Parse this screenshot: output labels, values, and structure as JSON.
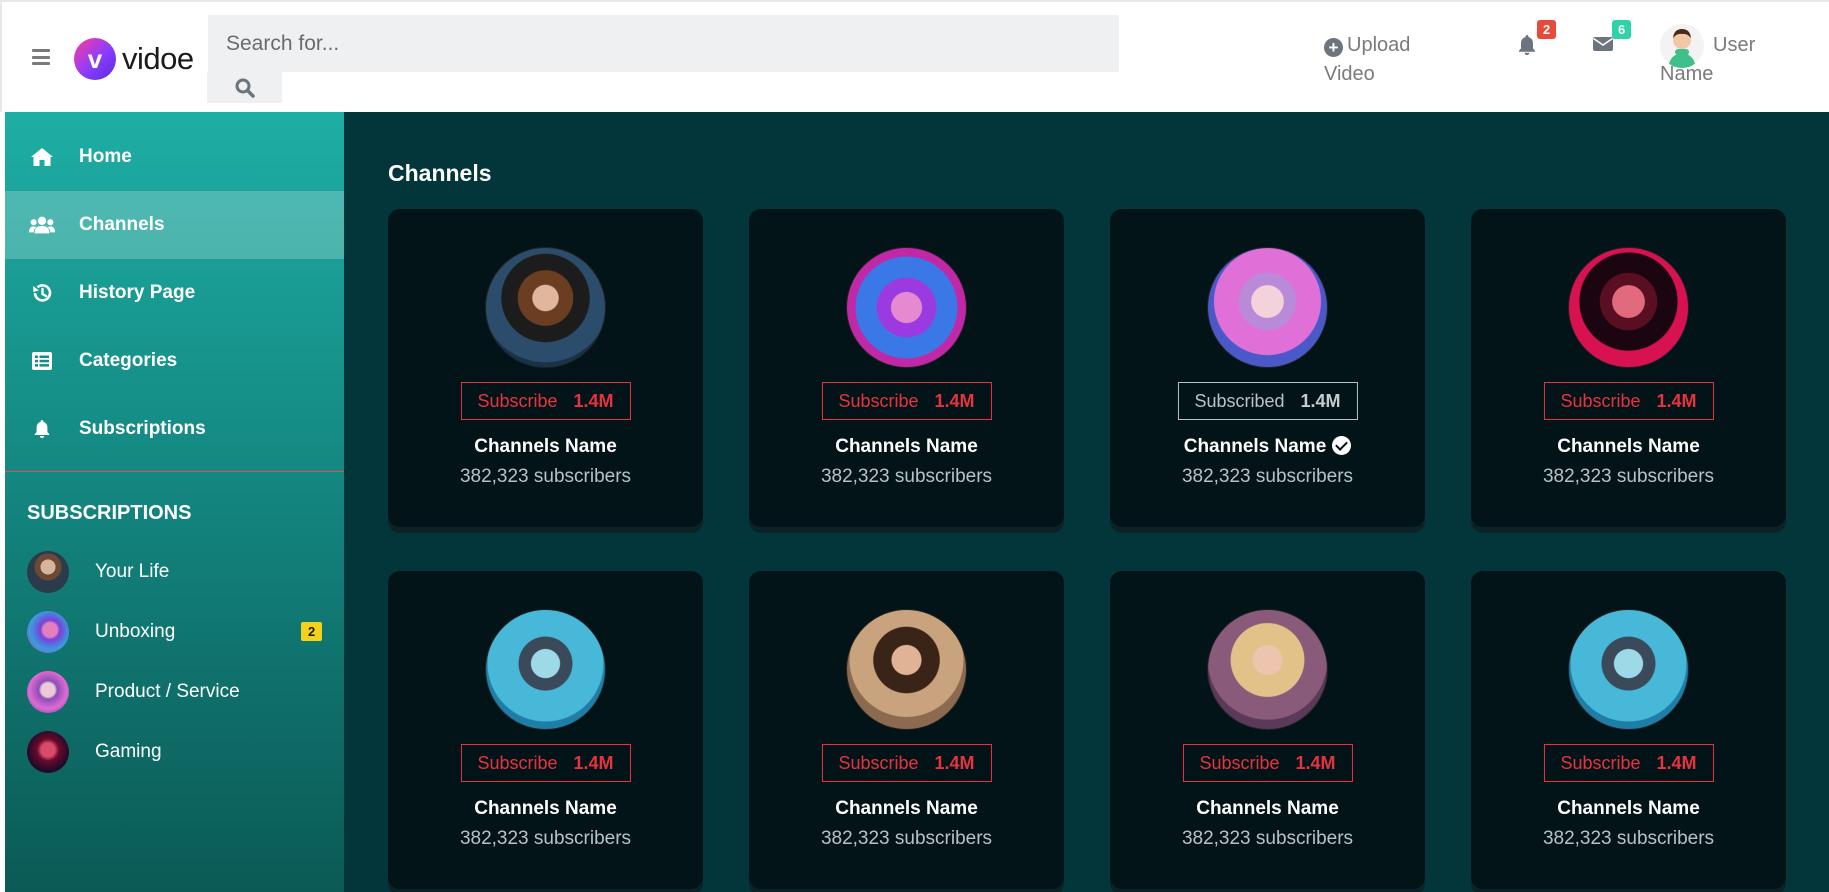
{
  "header": {
    "logo_letter": "v",
    "logo_text": "vidoe",
    "search_placeholder": "Search for...",
    "upload_label": "Upload Video",
    "notifications_count": "2",
    "messages_count": "6",
    "user_name": "User Name"
  },
  "sidebar": {
    "nav": [
      {
        "label": "Home",
        "icon": "home-icon"
      },
      {
        "label": "Channels",
        "icon": "users-icon",
        "active": true
      },
      {
        "label": "History Page",
        "icon": "history-icon"
      },
      {
        "label": "Categories",
        "icon": "list-icon"
      },
      {
        "label": "Subscriptions",
        "icon": "bell-icon"
      }
    ],
    "subscriptions_heading": "SUBSCRIPTIONS",
    "subscriptions": [
      {
        "label": "Your Life"
      },
      {
        "label": "Unboxing",
        "count": "2"
      },
      {
        "label": "Product / Service"
      },
      {
        "label": "Gaming"
      }
    ]
  },
  "main": {
    "title": "Channels",
    "channels": [
      {
        "button": "Subscribe",
        "count": "1.4M",
        "name": "Channels Name",
        "subscribers": "382,323 subscribers",
        "subscribed": false
      },
      {
        "button": "Subscribe",
        "count": "1.4M",
        "name": "Channels Name",
        "subscribers": "382,323 subscribers",
        "subscribed": false
      },
      {
        "button": "Subscribed",
        "count": "1.4M",
        "name": "Channels Name",
        "subscribers": "382,323 subscribers",
        "subscribed": true,
        "verified": true
      },
      {
        "button": "Subscribe",
        "count": "1.4M",
        "name": "Channels Name",
        "subscribers": "382,323 subscribers",
        "subscribed": false
      },
      {
        "button": "Subscribe",
        "count": "1.4M",
        "name": "Channels Name",
        "subscribers": "382,323 subscribers",
        "subscribed": false
      },
      {
        "button": "Subscribe",
        "count": "1.4M",
        "name": "Channels Name",
        "subscribers": "382,323 subscribers",
        "subscribed": false
      },
      {
        "button": "Subscribe",
        "count": "1.4M",
        "name": "Channels Name",
        "subscribers": "382,323 subscribers",
        "subscribed": false
      },
      {
        "button": "Subscribe",
        "count": "1.4M",
        "name": "Channels Name",
        "subscribers": "382,323 subscribers",
        "subscribed": false
      }
    ]
  },
  "colors": {
    "sidebar_top": "#1eaea4",
    "main_bg": "#02363a",
    "card_bg": "#031418",
    "subscribe_red": "#e8323f",
    "badge_red": "#e74a3b",
    "badge_teal": "#2ed3a8",
    "badge_yellow": "#f4d11a"
  }
}
